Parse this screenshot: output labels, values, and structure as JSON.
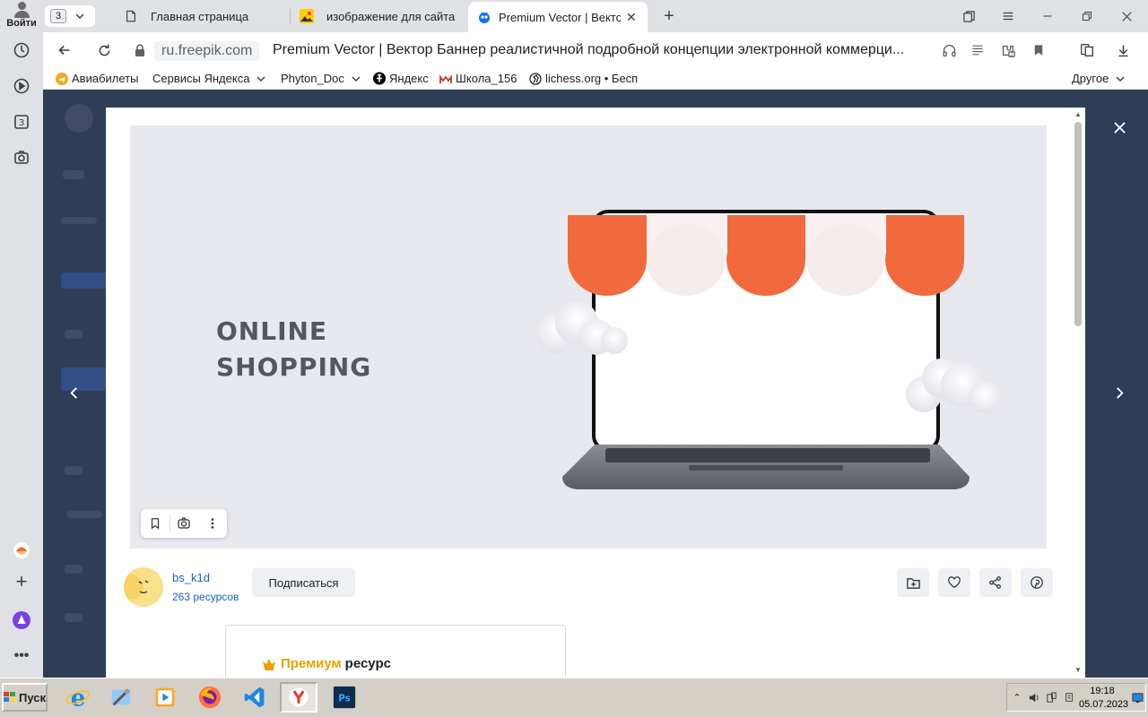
{
  "sidebar": {
    "login_label": "Войти"
  },
  "tabs": {
    "count": "3",
    "items": [
      {
        "title": "Главная страница"
      },
      {
        "title": "изображение для сайта по"
      },
      {
        "title": "Premium Vector | Вектор"
      }
    ],
    "close_glyph": "✕",
    "new_tab_glyph": "+"
  },
  "address": {
    "domain": "ru.freepik.com",
    "page_title": "Premium Vector | Вектор Баннер реалистичной подробной концепции электронной коммерци..."
  },
  "bookmarks": {
    "items": [
      {
        "label": "Авиабилеты"
      },
      {
        "label": "Сервисы Яндекса"
      },
      {
        "label": "Phyton_Doc"
      },
      {
        "label": "Яндекс"
      },
      {
        "label": "Школа_156"
      },
      {
        "label": "lichess.org • Бесп"
      }
    ],
    "other": "Другое"
  },
  "image": {
    "headline_line1": "ONLINE",
    "headline_line2": "SHOPPING"
  },
  "author": {
    "name": "bs_k1d",
    "resources": "263 ресурсов",
    "follow_label": "Подписаться"
  },
  "premium": {
    "word1": "Премиум",
    "word2": "ресурс"
  },
  "taskbar": {
    "start_label": "Пуск",
    "time": "19:18",
    "date": "05.07.2023"
  },
  "colors": {
    "link": "#1b5fc7",
    "premium": "#e8a202",
    "awning_orange": "#f06a3d",
    "backdrop": "#2f3d57"
  }
}
